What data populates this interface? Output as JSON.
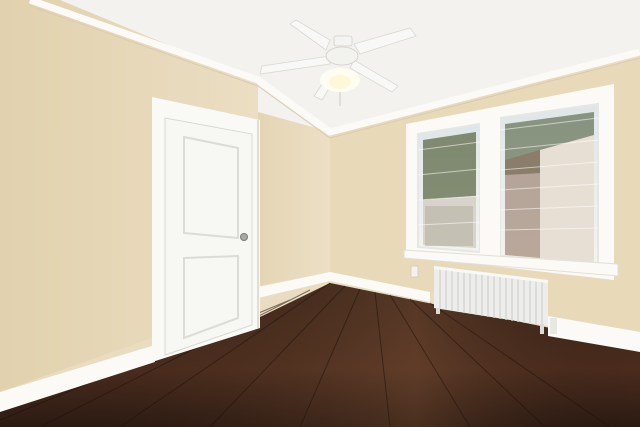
{
  "scene": {
    "colors": {
      "wall_left": "#e6d7b6",
      "wall_back": "#eadcbd",
      "wall_right": "#e8d9b9",
      "ceiling": "#f3f2ef",
      "trim": "#fbfaf7",
      "floor_dark": "#2b1a12",
      "floor_mid": "#4a2c1d",
      "floor_light": "#6e4530",
      "door": "#f7f7f4",
      "radiator": "#f1f1ef",
      "window_glass": "#e7ece6"
    },
    "icons": [
      "ceiling-fan-icon",
      "door-knob-icon",
      "radiator-icon",
      "window-icon"
    ]
  }
}
